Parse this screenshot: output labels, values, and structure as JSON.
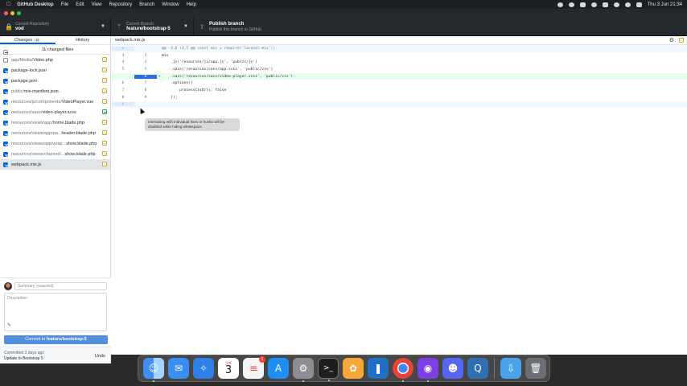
{
  "menubar": {
    "app_name": "GitHub Desktop",
    "items": [
      "File",
      "Edit",
      "View",
      "Repository",
      "Branch",
      "Window",
      "Help"
    ],
    "clock": "Thu 3 Jun  21:34"
  },
  "toolbar": {
    "repo_label": "Current Repository",
    "repo_value": "vod",
    "branch_label": "Current Branch",
    "branch_value": "feature/bootstrap-5",
    "publish_title": "Publish branch",
    "publish_sub": "Publish this branch to GitHub"
  },
  "sidebar": {
    "tab_changes": "Changes",
    "changes_count": "11",
    "tab_history": "History",
    "changed_files_label": "11 changed files",
    "files": [
      {
        "dir": "app/Media/",
        "name": "Video.php",
        "checked": false,
        "status": "modified"
      },
      {
        "dir": "",
        "name": "package-lock.json",
        "checked": true,
        "status": "modified"
      },
      {
        "dir": "",
        "name": "package.json",
        "checked": true,
        "status": "modified"
      },
      {
        "dir": "public/",
        "name": "mix-manifest.json",
        "checked": true,
        "status": "modified"
      },
      {
        "dir": "resources/js/components/",
        "name": "VideoPlayer.vue",
        "checked": true,
        "status": "modified"
      },
      {
        "dir": "resources/sass/",
        "name": "video-player.scss",
        "checked": true,
        "status": "added"
      },
      {
        "dir": "resources/views/app/",
        "name": "home.blade.php",
        "checked": true,
        "status": "modified"
      },
      {
        "dir": "resources/views/app/pa...",
        "name": "header.blade.php",
        "checked": true,
        "status": "modified"
      },
      {
        "dir": "resources/views/app/wrap...",
        "name": "show.blade.php",
        "checked": true,
        "status": "modified"
      },
      {
        "dir": "resources/views/channel/...",
        "name": "show.blade.php",
        "checked": true,
        "status": "modified"
      },
      {
        "dir": "",
        "name": "webpack.mix.js",
        "checked": true,
        "status": "modified"
      }
    ]
  },
  "commit": {
    "summary_placeholder": "Summary (required)",
    "description_placeholder": "Description",
    "button_prefix": "Commit to ",
    "button_branch": "feature/bootstrap-5"
  },
  "last_commit": {
    "time": "Committed 3 days ago",
    "message": "Update to Bootstrap 5",
    "undo": "Undo"
  },
  "diff": {
    "file_name": "webpack.mix.js",
    "hunk_header": "@@ -3,6 +3,7 @@ const mix = require('laravel-mix');",
    "lines": [
      {
        "old": "3",
        "new": "3",
        "sign": "",
        "code": "mix",
        "type": "ctx"
      },
      {
        "old": "4",
        "new": "4",
        "sign": "",
        "code": "    .js('resources/js/app.js', 'public/js')",
        "type": "ctx"
      },
      {
        "old": "5",
        "new": "5",
        "sign": "",
        "code": "    .sass('resources/sass/app.scss', 'public/css')",
        "type": "ctx"
      },
      {
        "old": "",
        "new": "6",
        "sign": "+",
        "code": "    .sass('resources/sass/video-player.scss', 'public/css')",
        "type": "add"
      },
      {
        "old": "6",
        "new": "7",
        "sign": "",
        "code": "    .options({",
        "type": "ctx"
      },
      {
        "old": "7",
        "new": "8",
        "sign": "",
        "code": "        processCssUrls: false",
        "type": "ctx"
      },
      {
        "old": "8",
        "new": "9",
        "sign": "",
        "code": "    });",
        "type": "ctx"
      }
    ],
    "tooltip": "Interacting with individual lines or hunks will be disabled while hiding whitespace."
  },
  "dock": {
    "calendar_month": "JUN",
    "calendar_day": "3",
    "reminders_badge": "1"
  }
}
